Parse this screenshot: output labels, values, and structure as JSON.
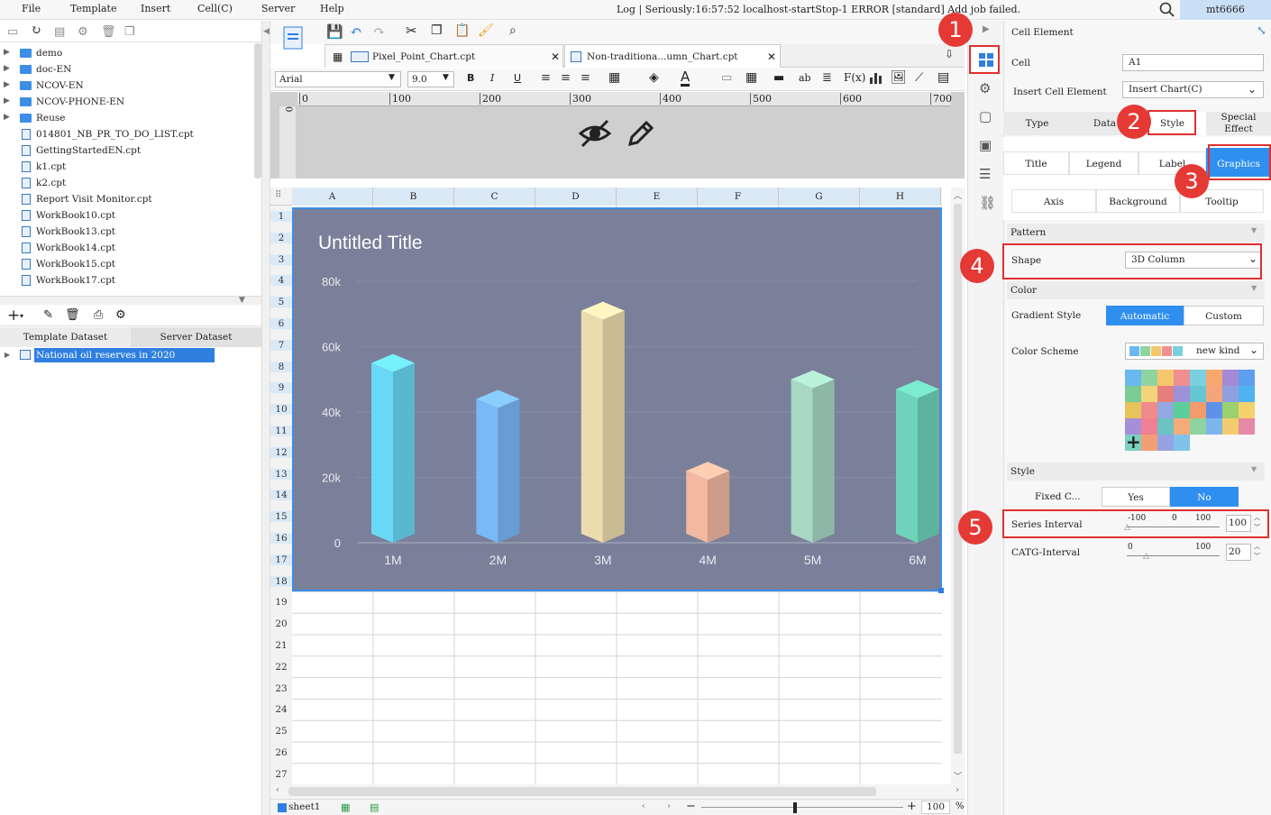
{
  "menu": [
    "File",
    "Template",
    "Insert",
    "Cell(C)",
    "Server",
    "Help"
  ],
  "log_text": "Log | Seriously:16:57:52 localhost-startStop-1 ERROR [standard] Add job failed.",
  "user": "mt6666",
  "tree": [
    {
      "label": "demo",
      "type": "folder"
    },
    {
      "label": "doc-EN",
      "type": "folder"
    },
    {
      "label": "NCOV-EN",
      "type": "folder"
    },
    {
      "label": "NCOV-PHONE-EN",
      "type": "folder"
    },
    {
      "label": "Reuse",
      "type": "folder"
    },
    {
      "label": "014801_NB_PR_TO_DO_LIST.cpt",
      "type": "file"
    },
    {
      "label": "GettingStartedEN.cpt",
      "type": "file"
    },
    {
      "label": "k1.cpt",
      "type": "file"
    },
    {
      "label": "k2.cpt",
      "type": "file"
    },
    {
      "label": "Report Visit Monitor.cpt",
      "type": "file"
    },
    {
      "label": "WorkBook10.cpt",
      "type": "file"
    },
    {
      "label": "WorkBook13.cpt",
      "type": "file"
    },
    {
      "label": "WorkBook14.cpt",
      "type": "file"
    },
    {
      "label": "WorkBook15.cpt",
      "type": "file"
    },
    {
      "label": "WorkBook17.cpt",
      "type": "file"
    }
  ],
  "dataset_tabs": [
    "Template Dataset",
    "Server Dataset"
  ],
  "dataset_item": "National oil reserves in 2020",
  "file_tabs": [
    "Pixel_Point_Chart.cpt",
    "Non-traditiona...umn_Chart.cpt"
  ],
  "font_name": "Arial",
  "font_size": "9.0",
  "ruler_ticks": [
    "0",
    "100",
    "200",
    "300",
    "400",
    "500",
    "600",
    "700"
  ],
  "columns": [
    "A",
    "B",
    "C",
    "D",
    "E",
    "F",
    "G",
    "H"
  ],
  "rows": [
    "1",
    "2",
    "3",
    "4",
    "5",
    "6",
    "7",
    "8",
    "9",
    "10",
    "11",
    "12",
    "13",
    "14",
    "15",
    "16",
    "17",
    "18",
    "19",
    "20",
    "21",
    "22",
    "23",
    "24",
    "25",
    "26",
    "27"
  ],
  "sheet_name": "sheet1",
  "zoom_value": "100",
  "zoom_unit": "%",
  "chart_data": {
    "type": "bar",
    "title": "Untitled Title",
    "categories": [
      "1M",
      "2M",
      "3M",
      "4M",
      "5M",
      "6M"
    ],
    "values": [
      55000,
      44000,
      71000,
      22000,
      50000,
      47000
    ],
    "ylim": [
      0,
      80000
    ],
    "yticks": [
      "0",
      "20k",
      "40k",
      "60k",
      "80k"
    ],
    "colors": [
      "#69d8f5",
      "#7ab8f7",
      "#ecdcad",
      "#f2b8a0",
      "#a6d8c4",
      "#6fd3bb"
    ]
  },
  "panel": {
    "header": "Cell Element",
    "cell_label": "Cell",
    "cell_value": "A1",
    "insert_label": "Insert Cell Element",
    "insert_value": "Insert Chart(C)",
    "top_tabs": [
      "Type",
      "Data",
      "Style",
      "Special Effect"
    ],
    "style_tabs_row1": [
      "Title",
      "Legend",
      "Label",
      "Graphics"
    ],
    "style_tabs_row2": [
      "Axis",
      "Background",
      "Tooltip"
    ],
    "pattern_section": "Pattern",
    "shape_label": "Shape",
    "shape_value": "3D Column",
    "color_section": "Color",
    "gradient_label": "Gradient Style",
    "gradient_options": [
      "Automatic",
      "Custom"
    ],
    "scheme_label": "Color Scheme",
    "scheme_value": "new kind",
    "style_section": "Style",
    "fixed_label": "Fixed C...",
    "fixed_options": [
      "Yes",
      "No"
    ],
    "series_label": "Series Interval",
    "series_ticks": [
      "-100",
      "0",
      "100"
    ],
    "series_value": "100",
    "catg_label": "CATG-Interval",
    "catg_ticks": [
      "0",
      "100"
    ],
    "catg_value": "20"
  },
  "badges": [
    "1",
    "2",
    "3",
    "4",
    "5"
  ],
  "palette": [
    "#69b8f0",
    "#8fd3a0",
    "#f5c66b",
    "#f08f8f",
    "#7bd0e0",
    "#f6a86d",
    "#a48ad6",
    "#5d9ef0",
    "#7acb96",
    "#f2d57a",
    "#e87f7f",
    "#9d91d8",
    "#65c6d3",
    "#f5a57a",
    "#8fa0e0",
    "#4fb3f0",
    "#e6c35c",
    "#ef8b8b",
    "#93a8e0",
    "#5bcf9b",
    "#f29c6b",
    "#5e92ea",
    "#9ccf6f",
    "#f3d26a",
    "#a78fd8",
    "#f07f94",
    "#6cc3c3",
    "#f5ab7a",
    "#8fd3a0",
    "#7cb6ec",
    "#f2cc6e",
    "#e58aa5",
    "#7cd1c1",
    "#f49e76",
    "#95a3e4",
    "#80c2ea"
  ]
}
